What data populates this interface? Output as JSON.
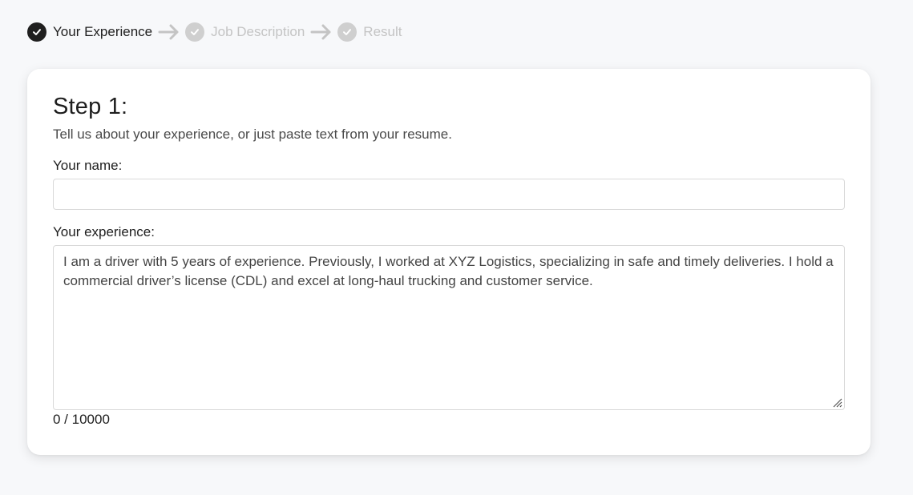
{
  "stepper": {
    "steps": [
      {
        "label": "Your Experience",
        "state": "active"
      },
      {
        "label": "Job Description",
        "state": "inactive"
      },
      {
        "label": "Result",
        "state": "inactive"
      }
    ]
  },
  "card": {
    "title": "Step 1:",
    "subtitle": "Tell us about your experience, or just paste text from your resume.",
    "name_label": "Your name:",
    "name_value": "",
    "experience_label": "Your experience:",
    "experience_value": "I am a driver with 5 years of experience. Previously, I worked at XYZ Logistics, specializing in safe and timely deliveries. I hold a commercial driver’s license (CDL) and excel at long-haul trucking and customer service.",
    "counter": "0 / 10000"
  },
  "icons": {
    "step_done": "check-icon",
    "step_arrow": "arrow-right-icon",
    "resize": "resize-grip-icon"
  },
  "colors": {
    "active_step": "#1f1f1f",
    "inactive_step": "#cfcfcf",
    "background": "#f7f8fa",
    "card": "#ffffff"
  }
}
